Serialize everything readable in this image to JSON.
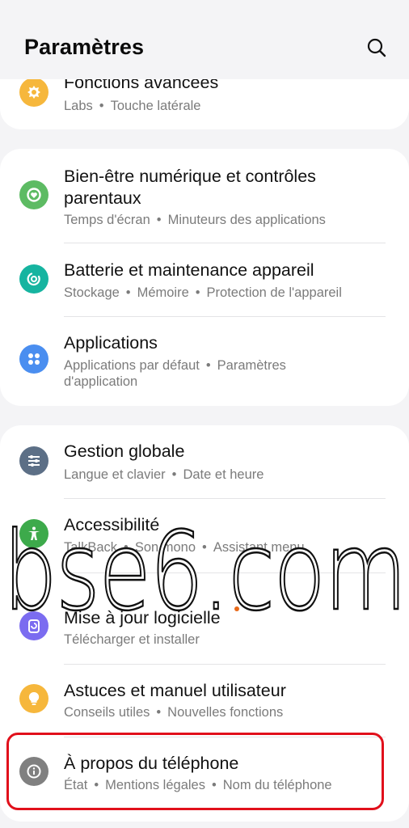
{
  "header": {
    "title": "Paramètres",
    "search_icon": "search-icon"
  },
  "items": [
    {
      "title": "Fonctions avancées",
      "subtitle": [
        "Labs",
        "Touche latérale"
      ],
      "icon": "advanced-features-icon",
      "color": "#f6b73c"
    },
    {
      "title_line1": "Bien-être numérique et contrôles",
      "title_line2": "parentaux",
      "subtitle": [
        "Temps d'écran",
        "Minuteurs des applications"
      ],
      "icon": "digital-wellbeing-icon",
      "color": "#5dbb63"
    },
    {
      "title": "Batterie et maintenance appareil",
      "subtitle": [
        "Stockage",
        "Mémoire",
        "Protection de l'appareil"
      ],
      "icon": "device-care-icon",
      "color": "#16b4a0"
    },
    {
      "title": "Applications",
      "subtitle_line1": "Applications par défaut",
      "subtitle_line1b": "Paramètres",
      "subtitle_line2": "d'application",
      "icon": "apps-icon",
      "color": "#4a8ef0"
    },
    {
      "title": "Gestion globale",
      "subtitle": [
        "Langue et clavier",
        "Date et heure"
      ],
      "icon": "general-management-icon",
      "color": "#5c6f86"
    },
    {
      "title": "Accessibilité",
      "subtitle": [
        "TalkBack",
        "Son mono",
        "Assistant menu"
      ],
      "icon": "accessibility-icon",
      "color": "#3daa4b"
    },
    {
      "title": "Mise à jour logicielle",
      "subtitle": [
        "Télécharger et installer"
      ],
      "icon": "software-update-icon",
      "color": "#7b6cf0"
    },
    {
      "title": "Astuces et manuel utilisateur",
      "subtitle": [
        "Conseils utiles",
        "Nouvelles fonctions"
      ],
      "icon": "tips-icon",
      "color": "#f6b73c"
    },
    {
      "title": "À propos du téléphone",
      "subtitle": [
        "État",
        "Mentions légales",
        "Nom du téléphone"
      ],
      "icon": "about-phone-icon",
      "color": "#808080"
    }
  ],
  "watermark": {
    "text": "bse6.com"
  },
  "separator": "•"
}
